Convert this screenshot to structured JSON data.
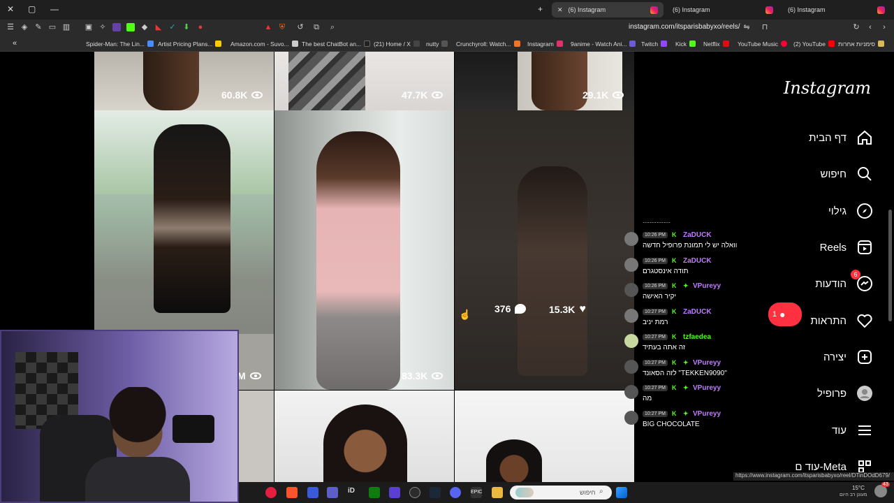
{
  "browser": {
    "tabs": [
      {
        "label": "(6) Instagram",
        "active": true
      },
      {
        "label": "(6) Instagram",
        "active": false
      },
      {
        "label": "(6) Instagram",
        "active": false
      }
    ],
    "url": "instagram.com/itsparisbabyxo/reels/",
    "bookmarks": [
      "Spider-Man: The Lin...",
      "Artist Pricing Plans...",
      "Amazon.com - Suvo...",
      "The best ChatBot an...",
      "(21) Home / X",
      "nutty",
      "Crunchyroll: Watch...",
      "Instagram",
      "9anime - Watch Ani...",
      "Twitch",
      "Kick",
      "Netflix",
      "YouTube Music",
      "(2) YouTube",
      "סימניות אחרות"
    ],
    "status_url": "https://www.instagram.com/itsparisbabyxo/reel/DTinDOdD679/"
  },
  "grid": {
    "top_row_views": [
      "60.8K",
      "47.7K",
      "29.1K"
    ],
    "mid_row_left_views": "M",
    "mid_row_center_views": "83.3K",
    "hover_comments": "376",
    "hover_likes": "15.3K"
  },
  "sidebar": {
    "logo": "Instagram",
    "items": [
      {
        "label": "דף הבית",
        "icon": "home-icon"
      },
      {
        "label": "חיפוש",
        "icon": "search-icon"
      },
      {
        "label": "גילוי",
        "icon": "compass-icon"
      },
      {
        "label": "Reels",
        "icon": "reels-icon"
      },
      {
        "label": "הודעות",
        "icon": "messenger-icon",
        "badge": "6"
      },
      {
        "label": "התראות",
        "icon": "heart-icon"
      },
      {
        "label": "יצירה",
        "icon": "plus-square-icon"
      },
      {
        "label": "פרופיל",
        "icon": "avatar-icon"
      },
      {
        "label": "עוד",
        "icon": "menu-icon"
      },
      {
        "label": "עוד ם-Meta",
        "icon": "meta-grid-icon"
      }
    ],
    "notification_count": "1"
  },
  "chat": {
    "top_fragment": "................",
    "messages": [
      {
        "time": "10:26 PM",
        "user": "ZaDUCK",
        "color": "#c07cff",
        "text": "וואלה יש לי תמונת פרופיל חדשה",
        "verified": false
      },
      {
        "time": "10:26 PM",
        "user": "ZaDUCK",
        "color": "#c07cff",
        "text": "תודה אינסטגרם",
        "verified": false
      },
      {
        "time": "10:26 PM",
        "user": "VPureyy",
        "color": "#c07cff",
        "text": "יקיר האישה",
        "verified": true
      },
      {
        "time": "10:27 PM",
        "user": "ZaDUCK",
        "color": "#c07cff",
        "text": "רמת יניב",
        "verified": false
      },
      {
        "time": "10:27 PM",
        "user": "tzfaedea",
        "color": "#53fc18",
        "text": "זה אתה בעתיד",
        "verified": false
      },
      {
        "time": "10:27 PM",
        "user": "VPureyy",
        "color": "#c07cff",
        "text": "לזה הסאונד \"TEKKEN9090\"",
        "verified": true
      },
      {
        "time": "10:27 PM",
        "user": "VPureyy",
        "color": "#c07cff",
        "text": "מה",
        "verified": true
      },
      {
        "time": "10:27 PM",
        "user": "VPureyy",
        "color": "#c07cff",
        "text": "BIG CHOCOLATE",
        "verified": true
      }
    ]
  },
  "taskbar": {
    "search_placeholder": "חיפוש",
    "weather": "15°C",
    "weather_text": "מעונן רב היום",
    "notif_count": "43"
  }
}
